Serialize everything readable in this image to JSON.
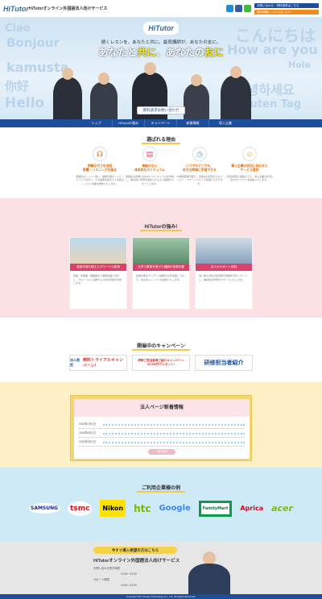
{
  "header": {
    "logo": "HiTutor",
    "site_title": "HiTutorオンライン外国語法人向けサービス",
    "btn_top": "お問い合わせ・資料請求はこちら",
    "btn_bottom": "無料体験レッスンはこちら"
  },
  "hero": {
    "logo": "HiTutor",
    "bg_words": [
      "Ciao",
      "Bonjour",
      "こんにちは",
      "How are you",
      "Hola",
      "kamusta",
      "你好",
      "Hello",
      "안녕하세요",
      "Guten Tag"
    ],
    "subline": "続くレスンを、あなたと共に。最良講師が、あなたの支に。",
    "headline_1": "あなたと",
    "headline_em1": "共に",
    "headline_2": "、あなたの",
    "headline_em2": "友に",
    "cta": "資料請求お問い合わせ"
  },
  "nav": [
    "トップ",
    "HiTutorの強み",
    "キャンペーン",
    "新着情報",
    "導入企業"
  ],
  "reasons": {
    "title": "選ばれる理由",
    "items": [
      {
        "title": "明確な行うを会話\n影響・リスニングの強化",
        "text": "受講生のレッスン後に、講師が細かくフィードバックを行い、その結果を踏まえて次回のレッスン内容を調整いたします。"
      },
      {
        "title": "無駄のない\n体系的なカリキュラム",
        "text": "受講生の目標に合わせたカリキュラムを作成し、体系的に学習を進められるよう講師がサポートします。"
      },
      {
        "title": "いつでもどこでも、\n好きな時間に学習できる",
        "text": "24時間受講可能で、出張先や自宅からもパソコン・スマートフォンで受講いただけます。"
      },
      {
        "title": "導入企業の状況に合わせた\nサービス提供",
        "text": "ご担当者様と相談のうえ、導入企業の状況に合わせてプランを提案いたします。"
      }
    ]
  },
  "strengths": {
    "title": "HiTutorの強み!",
    "cards": [
      {
        "label": "英語学習を超えたグローバル教育",
        "text": "英語・中国語・韓国語など複数言語に対応し、グローバルに活躍する人材の育成を支援します。"
      },
      {
        "label": "大学で教育を受けた講師が多数在籍",
        "text": "採用基準をクリアした講師のみが在籍しており、質の高いレッスンを提供いたします。"
      },
      {
        "label": "法人のサポート体制",
        "text": "導入後も専任の担当者が受講状況をレポートし、継続的な学習をサポートいたします。"
      }
    ]
  },
  "campaign": {
    "title": "開催中のキャンペーン",
    "banner1_tag": "法人限定",
    "banner1": "無料トライアルキャンペーン!",
    "banner2": "研修ご担当者様ご紹介キャンペーン 50,000円プレゼント!",
    "banner3": "研修担当者紹介"
  },
  "news": {
    "title": "法人ページ新着情報",
    "items": [
      {
        "date": "2018年7月1日"
      },
      {
        "date": "2018年6月1日"
      },
      {
        "date": "2018年5月1日"
      }
    ],
    "more": "一覧を見る"
  },
  "clients": {
    "title": "ご利用企業様の例",
    "logos": [
      "SAMSUNG",
      "tsmc",
      "Nikon",
      "htc",
      "Google",
      "FamilyMart",
      "Aprica",
      "acer"
    ]
  },
  "footer": {
    "button": "今すぐ導入希望の方はこちら",
    "title": "HiTutorオンライン外国語法人向けサービス",
    "line1": "お問い合わせ受付時間",
    "line2": "10:00～19:00",
    "line3": "サポート時間",
    "line4": "10:00～22:00",
    "copyright": "Copyright 2017 Hitutor Technology Co., Ltd. All Rights Reserved."
  },
  "colors": {
    "brand": "#1d4e9c",
    "accent": "#f2c94c",
    "pink": "#d9436b"
  }
}
